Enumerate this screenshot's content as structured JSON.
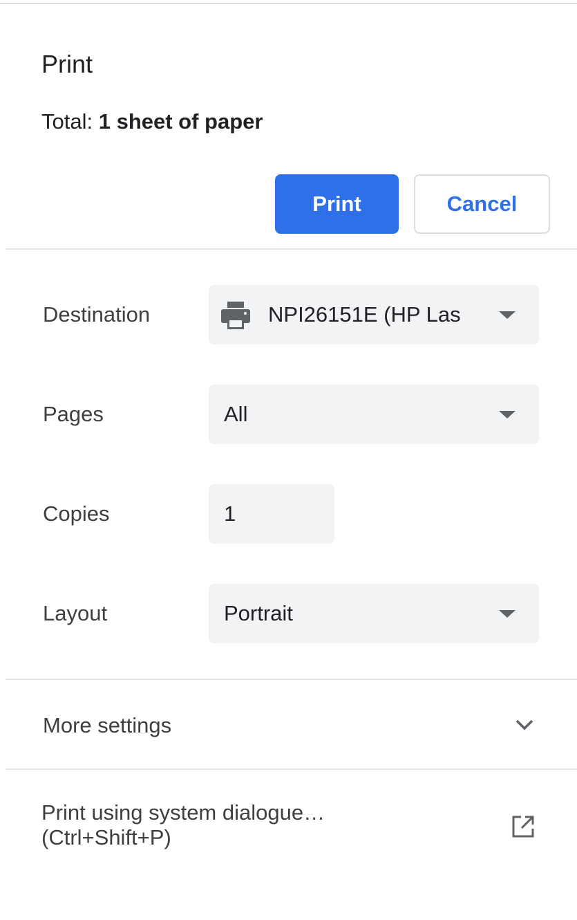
{
  "header": {
    "title": "Print",
    "summary_prefix": "Total: ",
    "summary_value": "1 sheet of paper"
  },
  "actions": {
    "print_label": "Print",
    "cancel_label": "Cancel"
  },
  "settings": {
    "destination": {
      "label": "Destination",
      "value": "NPI26151E (HP Las",
      "icon": "printer-icon"
    },
    "pages": {
      "label": "Pages",
      "value": "All"
    },
    "copies": {
      "label": "Copies",
      "value": "1"
    },
    "layout": {
      "label": "Layout",
      "value": "Portrait"
    }
  },
  "more_settings": {
    "label": "More settings",
    "icon": "chevron-down-icon"
  },
  "system_dialog": {
    "line1": "Print using system dialogue…",
    "line2": "(Ctrl+Shift+P)",
    "icon": "open-in-new-icon"
  },
  "colors": {
    "accent": "#2f6fe8",
    "field_bg": "#f1f3f4",
    "divider": "#e3e4e6",
    "text": "#202124"
  }
}
